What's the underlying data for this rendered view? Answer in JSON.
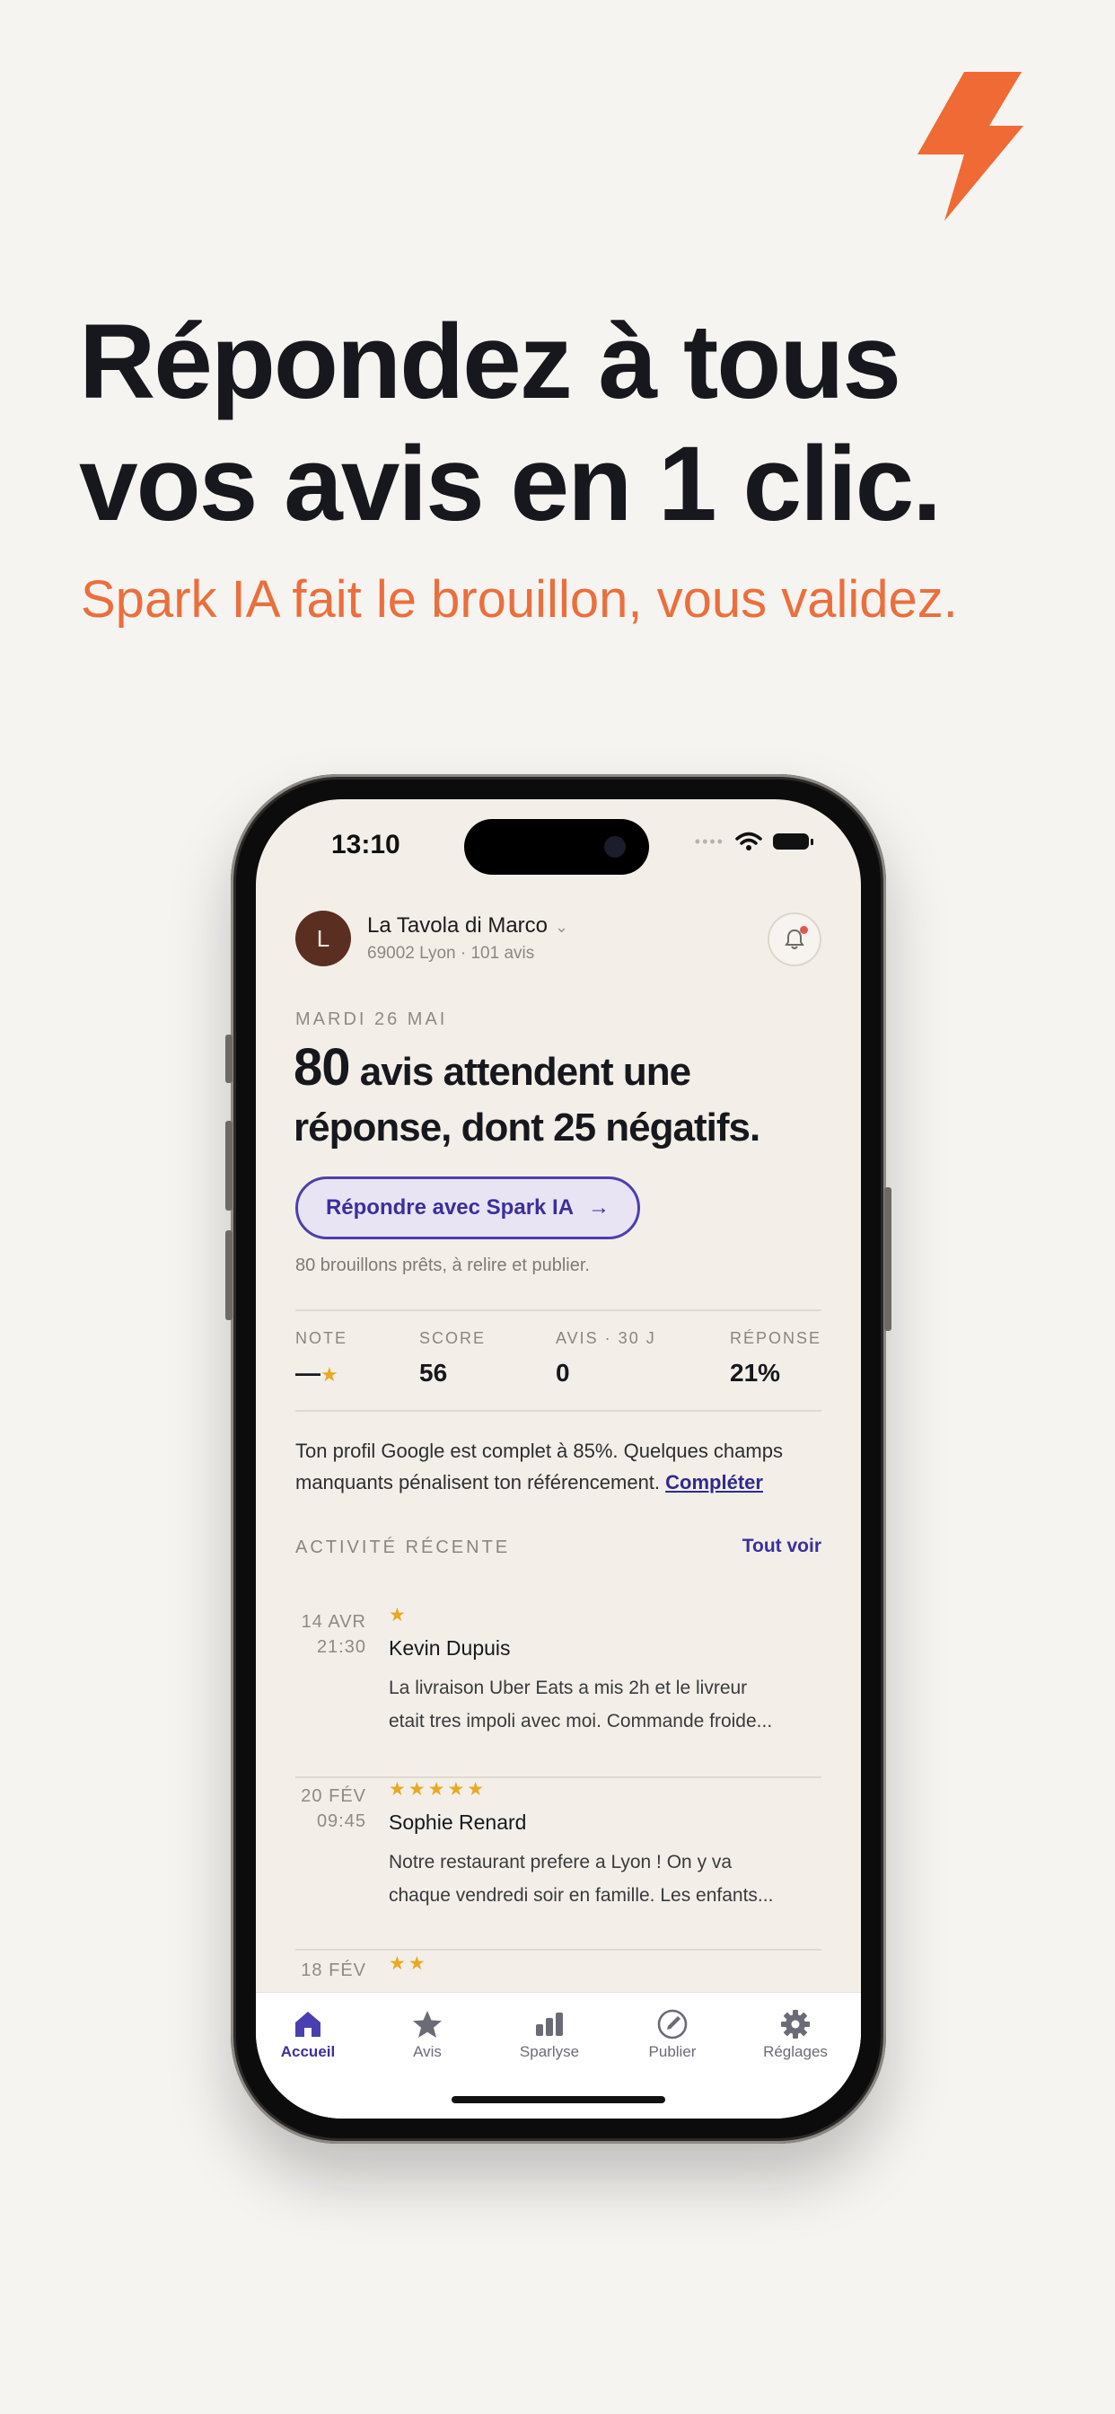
{
  "hero": {
    "headline_line1": "Répondez à tous",
    "headline_line2": "vos avis en 1 clic.",
    "subline": "Spark IA fait le brouillon, vous validez.",
    "accent_color": "#ea6f3d",
    "logo_icon": "lightning-bolt-icon"
  },
  "status_bar": {
    "time": "13:10",
    "icons": [
      "signal-dots-icon",
      "wifi-icon",
      "battery-icon"
    ]
  },
  "business": {
    "avatar_initial": "L",
    "name": "La Tavola di Marco",
    "meta": "69002 Lyon · 101 avis",
    "notification_icon": "bell-icon"
  },
  "dashboard": {
    "date": "MARDI 26 MAI",
    "count": "80",
    "title_rest": " avis attendent une réponse, dont 25 négatifs.",
    "cta_label": "Répondre avec Spark IA",
    "cta_arrow": "→",
    "drafts_note": "80 brouillons prêts, à relire et publier.",
    "brand_color": "#3b2f9c"
  },
  "stats": [
    {
      "label": "NOTE",
      "value": "—",
      "suffix": "★"
    },
    {
      "label": "SCORE",
      "value": "56",
      "suffix": ""
    },
    {
      "label": "AVIS · 30 J",
      "value": "0",
      "suffix": ""
    },
    {
      "label": "RÉPONSE",
      "value": "21%",
      "suffix": ""
    }
  ],
  "profile_message": {
    "text": "Ton profil Google est complet à 85%. Quelques champs manquants pénalisent ton référencement. ",
    "link": "Compléter"
  },
  "recent": {
    "label": "ACTIVITÉ RÉCENTE",
    "see_all": "Tout voir",
    "reviews": [
      {
        "day": "14 AVR",
        "time": "21:30",
        "stars": "★",
        "rating": 1,
        "name": "Kevin Dupuis",
        "line1": "La livraison Uber Eats a mis 2h et le livreur",
        "line2": "etait tres impoli avec moi. Commande froide..."
      },
      {
        "day": "20 FÉV",
        "time": "09:45",
        "stars": "★★★★★",
        "rating": 5,
        "name": "Sophie Renard",
        "line1": "Notre restaurant prefere a Lyon ! On y va",
        "line2": "chaque vendredi soir en famille. Les enfants..."
      },
      {
        "day": "18 FÉV",
        "time": "",
        "stars": "★★",
        "rating": 2,
        "name": "",
        "line1": "",
        "line2": ""
      }
    ]
  },
  "tabbar": [
    {
      "label": "Accueil",
      "icon": "home-icon",
      "active": true
    },
    {
      "label": "Avis",
      "icon": "star-icon",
      "active": false
    },
    {
      "label": "Sparlyse",
      "icon": "bar-chart-icon",
      "active": false
    },
    {
      "label": "Publier",
      "icon": "compose-icon",
      "active": false
    },
    {
      "label": "Réglages",
      "icon": "gear-icon",
      "active": false
    }
  ]
}
